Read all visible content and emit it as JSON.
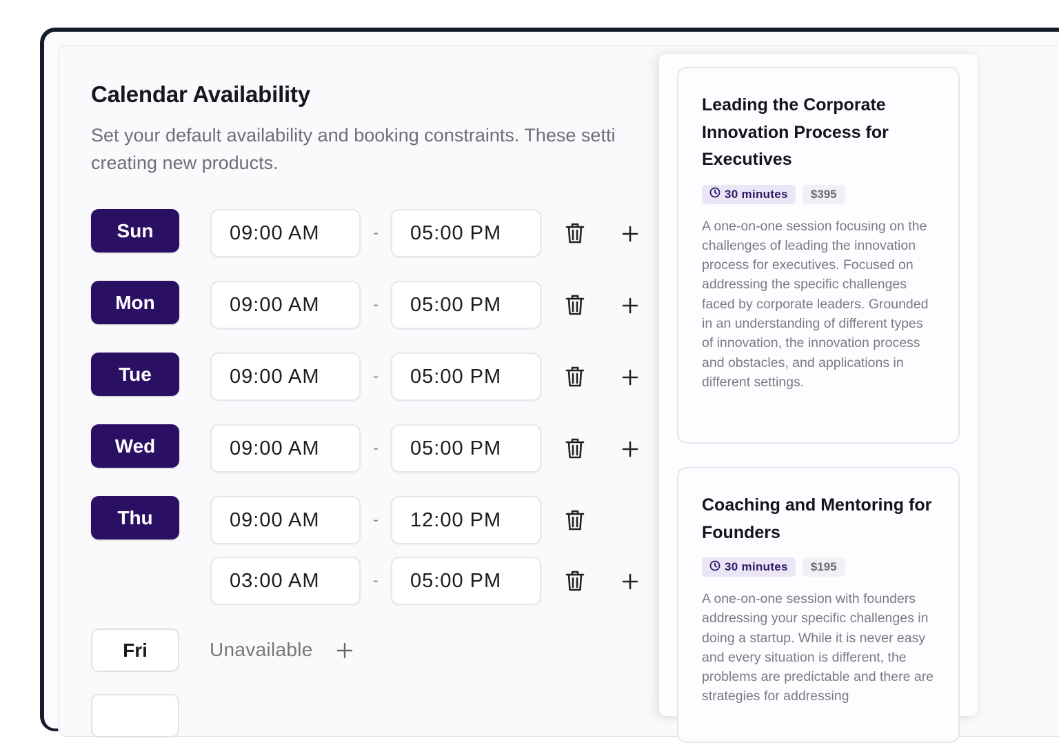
{
  "header": {
    "title": "Calendar Availability",
    "subtitle": "Set your default availability and booking constraints. These setti",
    "subtitle_line2": "creating new products."
  },
  "schedule": {
    "separator": "-",
    "rows": [
      {
        "day": "Sun",
        "start": "09:00 AM",
        "end": "05:00 PM"
      },
      {
        "day": "Mon",
        "start": "09:00 AM",
        "end": "05:00 PM"
      },
      {
        "day": "Tue",
        "start": "09:00 AM",
        "end": "05:00 PM"
      },
      {
        "day": "Wed",
        "start": "09:00 AM",
        "end": "05:00 PM"
      },
      {
        "day": "Thu",
        "start": "09:00 AM",
        "end": "12:00 PM"
      },
      {
        "day": "",
        "start": "03:00 AM",
        "end": "05:00 PM"
      },
      {
        "day": "Fri",
        "status": "Unavailable"
      }
    ]
  },
  "products": [
    {
      "title": "Leading the Corporate Innovation Process for Executives",
      "duration": "30 minutes",
      "price": "$395",
      "description": "A one-on-one session focusing on the challenges of leading the innovation process for executives. Focused on addressing the specific challenges faced by corporate leaders. Grounded in an understanding of different types of innovation, the innovation process and obstacles, and applications in different settings."
    },
    {
      "title": "Coaching and Mentoring for Founders",
      "duration": "30 minutes",
      "price": "$195",
      "description": "A one-on-one session with founders addressing your specific challenges in doing a startup. While it is never easy and every situation is different, the problems are predictable and there are strategies for addressing"
    }
  ],
  "icons": {
    "trash": "trash-icon",
    "add": "plus-icon",
    "clock": "clock-icon"
  },
  "colors": {
    "accent": "#2a0f63",
    "badge_bg": "#ebe6f6"
  }
}
